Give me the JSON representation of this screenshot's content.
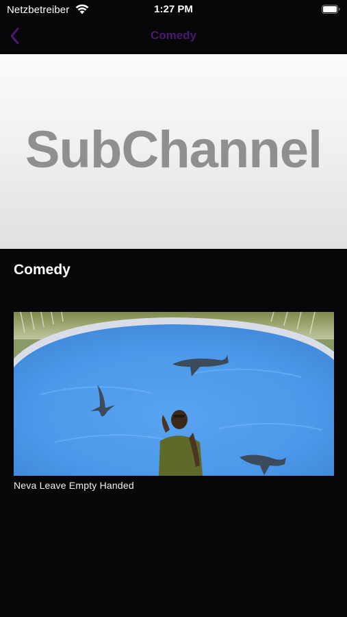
{
  "status_bar": {
    "carrier": "Netzbetreiber",
    "time": "1:27 PM",
    "wifi_icon": "wifi-icon",
    "battery_icon": "battery-full-icon"
  },
  "nav": {
    "title": "Comedy",
    "back_icon": "chevron-left-icon",
    "accent_color": "#4b1a6e"
  },
  "banner": {
    "text": "SubChannel"
  },
  "section": {
    "title": "Comedy",
    "videos": [
      {
        "title": "Neva Leave Empty Handed"
      }
    ]
  }
}
